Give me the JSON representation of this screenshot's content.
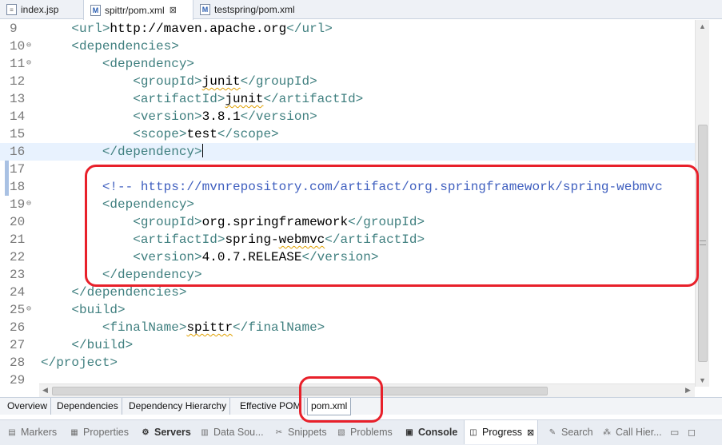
{
  "editor_tabs": [
    {
      "label": "index.jsp",
      "icon": "jsp-file-icon"
    },
    {
      "label": "spittr/pom.xml",
      "icon": "maven-file-icon",
      "close": "⊠"
    },
    {
      "label": "testspring/pom.xml",
      "icon": "maven-file-icon"
    }
  ],
  "lines": [
    {
      "n": "9",
      "parts": [
        [
          "tag",
          "    <url>"
        ],
        [
          "txt",
          "http://maven.apache.org"
        ],
        [
          "tag",
          "</url>"
        ]
      ]
    },
    {
      "n": "10",
      "fold": "⊖",
      "parts": [
        [
          "tag",
          "    <dependencies>"
        ]
      ]
    },
    {
      "n": "11",
      "fold": "⊖",
      "parts": [
        [
          "tag",
          "        <dependency>"
        ]
      ]
    },
    {
      "n": "12",
      "parts": [
        [
          "tag",
          "            <groupId>"
        ],
        [
          "txt-squig",
          "junit"
        ],
        [
          "tag",
          "</groupId>"
        ]
      ]
    },
    {
      "n": "13",
      "parts": [
        [
          "tag",
          "            <artifactId>"
        ],
        [
          "txt-squig",
          "junit"
        ],
        [
          "tag",
          "</artifactId>"
        ]
      ]
    },
    {
      "n": "14",
      "parts": [
        [
          "tag",
          "            <version>"
        ],
        [
          "txt",
          "3.8.1"
        ],
        [
          "tag",
          "</version>"
        ]
      ]
    },
    {
      "n": "15",
      "parts": [
        [
          "tag",
          "            <scope>"
        ],
        [
          "txt",
          "test"
        ],
        [
          "tag",
          "</scope>"
        ]
      ]
    },
    {
      "n": "16",
      "current": true,
      "parts": [
        [
          "tag",
          "        </dependency>"
        ],
        [
          "caret",
          ""
        ]
      ]
    },
    {
      "n": "17",
      "parts": []
    },
    {
      "n": "18",
      "parts": [
        [
          "cmt",
          "        <!-- https://mvnrepository.com/artifact/org.springframework/spring-webmvc"
        ]
      ]
    },
    {
      "n": "19",
      "fold": "⊖",
      "parts": [
        [
          "tag",
          "        <dependency>"
        ]
      ]
    },
    {
      "n": "20",
      "parts": [
        [
          "tag",
          "            <groupId>"
        ],
        [
          "txt",
          "org.springframework"
        ],
        [
          "tag",
          "</groupId>"
        ]
      ]
    },
    {
      "n": "21",
      "parts": [
        [
          "tag",
          "            <artifactId>"
        ],
        [
          "txt",
          "spring-"
        ],
        [
          "txt-squig",
          "webmvc"
        ],
        [
          "tag",
          "</artifactId>"
        ]
      ]
    },
    {
      "n": "22",
      "parts": [
        [
          "tag",
          "            <version>"
        ],
        [
          "txt",
          "4.0.7.RELEASE"
        ],
        [
          "tag",
          "</version>"
        ]
      ]
    },
    {
      "n": "23",
      "parts": [
        [
          "tag",
          "        </dependency>"
        ]
      ]
    },
    {
      "n": "24",
      "parts": [
        [
          "tag",
          "    </dependencies>"
        ]
      ]
    },
    {
      "n": "25",
      "fold": "⊖",
      "parts": [
        [
          "tag",
          "    <build>"
        ]
      ]
    },
    {
      "n": "26",
      "parts": [
        [
          "tag",
          "        <finalName>"
        ],
        [
          "txt-squig",
          "spittr"
        ],
        [
          "tag",
          "</finalName>"
        ]
      ]
    },
    {
      "n": "27",
      "parts": [
        [
          "tag",
          "    </build>"
        ]
      ]
    },
    {
      "n": "28",
      "parts": [
        [
          "tag",
          "</project>"
        ]
      ]
    },
    {
      "n": "29",
      "parts": []
    }
  ],
  "page_tabs": [
    {
      "label": "Overview"
    },
    {
      "label": "Dependencies"
    },
    {
      "label": "Dependency Hierarchy"
    },
    {
      "label": "Effective POM"
    },
    {
      "label": "pom.xml",
      "active": true
    }
  ],
  "views": [
    {
      "label": "Markers",
      "icon": "markers-icon"
    },
    {
      "label": "Properties",
      "icon": "properties-icon"
    },
    {
      "label": "Servers",
      "icon": "servers-icon",
      "bold": true
    },
    {
      "label": "Data Sou...",
      "icon": "data-source-icon"
    },
    {
      "label": "Snippets",
      "icon": "snippets-icon"
    },
    {
      "label": "Problems",
      "icon": "problems-icon"
    },
    {
      "label": "Console",
      "icon": "console-icon",
      "bold": true
    },
    {
      "label": "Progress",
      "icon": "progress-icon",
      "active": true,
      "close": "⊠"
    },
    {
      "label": "Search",
      "icon": "search-icon"
    },
    {
      "label": "Call Hier...",
      "icon": "call-hierarchy-icon"
    }
  ],
  "colors": {
    "accent_annotation": "#e8202a",
    "xml_tag": "#3f7f7f",
    "xml_comment": "#3f5fbf"
  }
}
